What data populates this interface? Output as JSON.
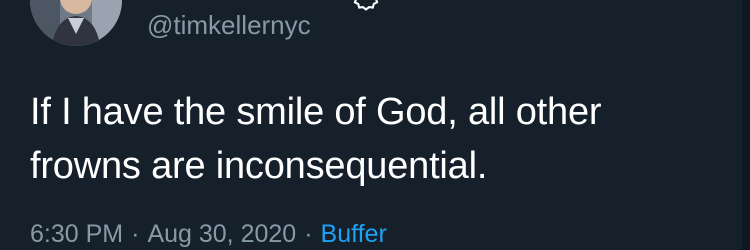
{
  "author": {
    "handle": "@timkellernyc",
    "verified": true
  },
  "tweet": {
    "text": "If I have the smile of God, all other frowns are inconsequential."
  },
  "meta": {
    "time": "6:30 PM",
    "separator": "·",
    "date": "Aug 30, 2020",
    "source": "Buffer"
  },
  "colors": {
    "background": "#15202b",
    "text": "#ffffff",
    "muted": "#8899a6",
    "link": "#1da1f2"
  }
}
